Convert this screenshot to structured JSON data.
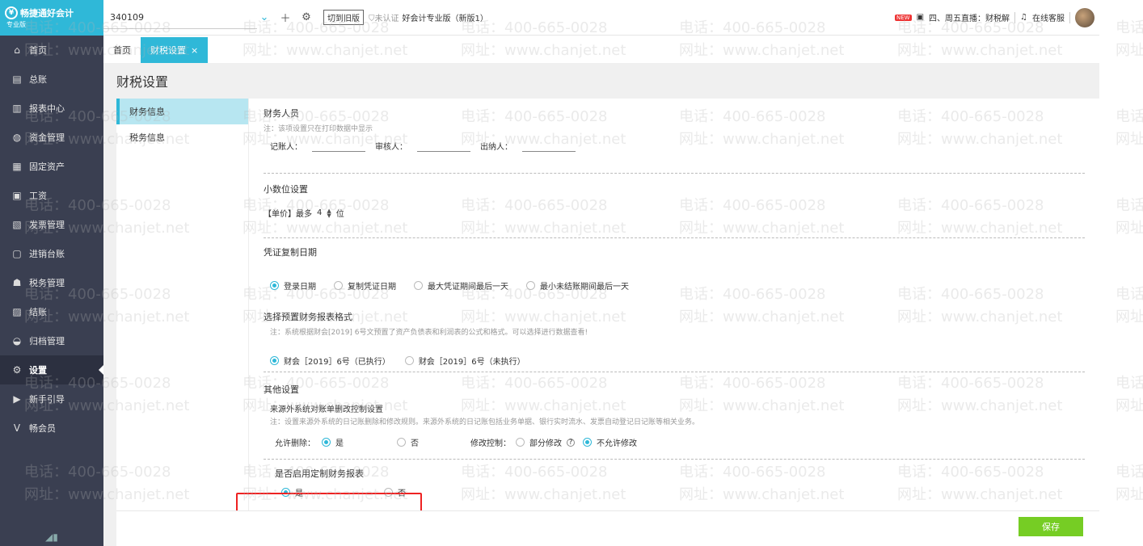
{
  "brand": {
    "name": "畅捷通好会计",
    "edition_badge": "专业版"
  },
  "sidebar": {
    "items": [
      {
        "label": "首页",
        "icon": "home-icon",
        "glyph": "⌂"
      },
      {
        "label": "总账",
        "icon": "ledger-icon",
        "glyph": "▤"
      },
      {
        "label": "报表中心",
        "icon": "chart-icon",
        "glyph": "▥"
      },
      {
        "label": "资金管理",
        "icon": "money-icon",
        "glyph": "◍"
      },
      {
        "label": "固定资产",
        "icon": "asset-icon",
        "glyph": "▦"
      },
      {
        "label": "工资",
        "icon": "salary-icon",
        "glyph": "▣"
      },
      {
        "label": "发票管理",
        "icon": "invoice-icon",
        "glyph": "▧"
      },
      {
        "label": "进销台账",
        "icon": "inventory-icon",
        "glyph": "▢"
      },
      {
        "label": "税务管理",
        "icon": "tax-icon",
        "glyph": "☗"
      },
      {
        "label": "结账",
        "icon": "closing-icon",
        "glyph": "▨"
      },
      {
        "label": "归档管理",
        "icon": "archive-icon",
        "glyph": "◒"
      },
      {
        "label": "设置",
        "icon": "gear-icon",
        "glyph": "⚙"
      },
      {
        "label": "新手引导",
        "icon": "guide-icon",
        "glyph": "▶"
      },
      {
        "label": "畅会员",
        "icon": "member-icon",
        "glyph": "V"
      }
    ],
    "active_index": 11
  },
  "topbar": {
    "account": "340109",
    "switch_old": "切到旧版",
    "uncertified": "未认证",
    "edition": "好会计专业版（新版1）",
    "live": "四、周五直播：财税解",
    "service": "在线客服",
    "new_badge": "NEW"
  },
  "tabs": [
    {
      "label": "首页"
    },
    {
      "label": "财税设置",
      "close": "×"
    }
  ],
  "page": {
    "title": "财税设置"
  },
  "subnav": [
    "财务信息",
    "税务信息"
  ],
  "form": {
    "staff": {
      "title": "财务人员",
      "note": "注：该项设置只在打印数据中显示",
      "bookkeeper": "记账人：",
      "reviewer": "审核人：",
      "cashier": "出纳人："
    },
    "decimal": {
      "title": "小数位设置",
      "prefix": "【单价】最多",
      "value": "4",
      "suffix": "位"
    },
    "voucher_copy": {
      "title": "凭证复制日期",
      "options": [
        "登录日期",
        "复制凭证日期",
        "最大凭证期间最后一天",
        "最小未结账期间最后一天"
      ],
      "selected": 0
    },
    "report_format": {
      "title": "选择预置财务报表格式",
      "note": "注：系统根据财会[2019] 6号文预置了资产负债表和利润表的公式和格式。可以选择进行数据查看!",
      "options": [
        "财会［2019］6号（已执行）",
        "财会［2019］6号（未执行）"
      ],
      "selected": 0
    },
    "other": {
      "title": "其他设置",
      "subtitle": "来源外系统对账单删改控制设置",
      "note": "注：设置来源外系统的日记账删除和修改规则。来源外系统的日记账包括业务单据、银行实时流水、发票自动登记日记账等相关业务。",
      "allow_delete_label": "允许删除：",
      "delete_options": [
        "是",
        "否"
      ],
      "delete_selected": 0,
      "modify_label": "修改控制：",
      "modify_options": [
        "部分修改",
        "不允许修改"
      ],
      "modify_selected": 1,
      "help": "?"
    },
    "custom_report": {
      "title": "是否启用定制财务报表",
      "options": [
        "是",
        "否"
      ],
      "selected": 0
    }
  },
  "footer": {
    "save": "保存"
  },
  "watermark": {
    "phone": "电话：400-665-0028",
    "site": "网址：www.chanjet.net"
  },
  "colors": {
    "accent": "#2fb8d8",
    "sidebar": "#3a3f51",
    "save": "#76cd24",
    "highlight": "#e22222"
  }
}
